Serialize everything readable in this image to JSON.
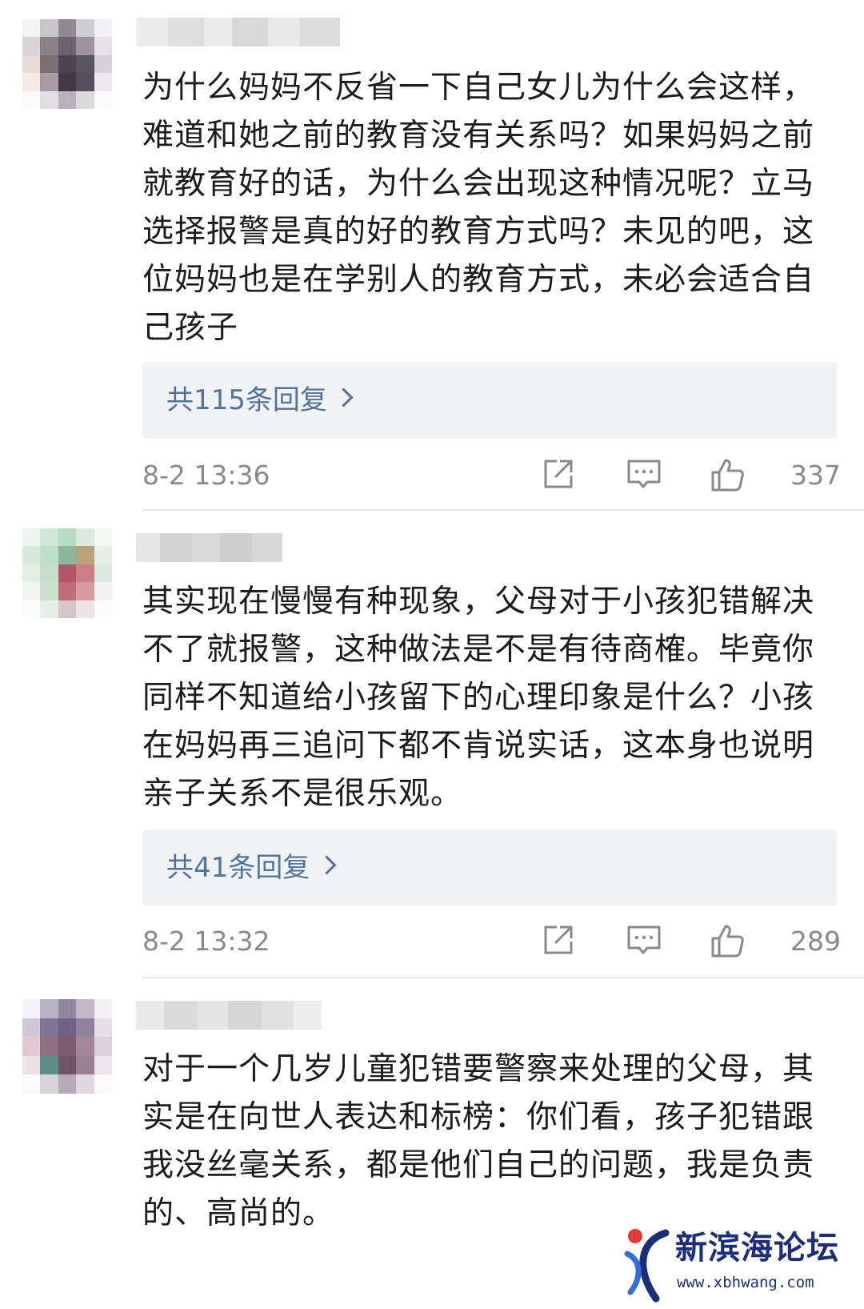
{
  "comments": [
    {
      "text": "为什么妈妈不反省一下自己女儿为什么会这样，难道和她之前的教育没有关系吗？如果妈妈之前就教育好的话，为什么会出现这种情况呢？立马选择报警是真的好的教育方式吗？未见的吧，这位妈妈也是在学别人的教育方式，未必会适合自己孩子",
      "replies_label": "共115条回复",
      "time": "8-2 13:36",
      "likes": "337"
    },
    {
      "text": "其实现在慢慢有种现象，父母对于小孩犯错解决不了就报警，这种做法是不是有待商榷。毕竟你同样不知道给小孩留下的心理印象是什么？小孩在妈妈再三追问下都不肯说实话，这本身也说明亲子关系不是很乐观。",
      "replies_label": "共41条回复",
      "time": "8-2 13:32",
      "likes": "289"
    },
    {
      "text": "对于一个几岁儿童犯错要警察来处理的父母，其实是在向世人表达和标榜：你们看，孩子犯错跟我没丝毫关系，都是他们自己的问题，我是负责的、高尚的。"
    }
  ],
  "icons": {
    "share": "share-icon",
    "comment": "comment-icon",
    "like": "thumbs-up-icon"
  },
  "watermark": {
    "name": "新滨海论坛",
    "url": "www.xbhwang.com"
  },
  "colors": {
    "reply_link": "#51739d",
    "meta_text": "#8a8a8a",
    "reply_box_bg": "#f1f2f4",
    "watermark": "#1c2e7a",
    "watermark_accent": "#e03a3a"
  }
}
